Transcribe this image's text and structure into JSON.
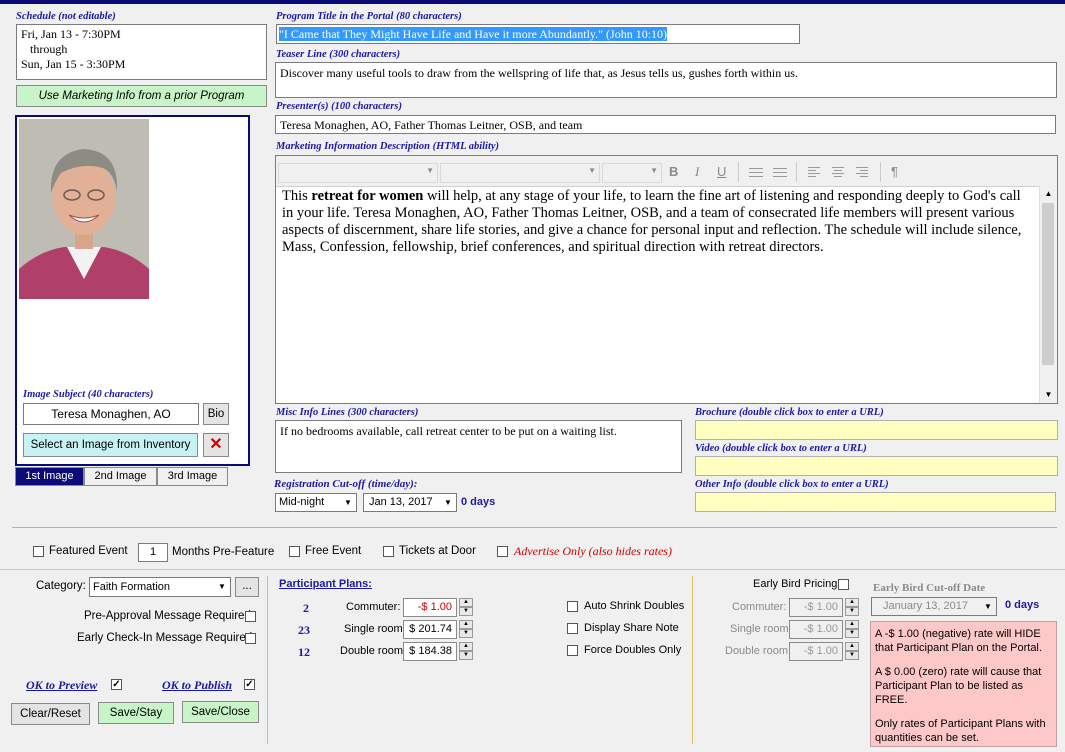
{
  "colors": {
    "accent": "#1a1aa6",
    "top_bar": "#0a0a78",
    "field_yellow": "#ffffc0",
    "button_green": "#c8f5c8",
    "info_pink": "#ffc8c8",
    "red": "#cc0000"
  },
  "schedule": {
    "label": "Schedule (not editable)",
    "line1": "Fri, Jan 13 - 7:30PM",
    "line2": "through",
    "line3": "Sun, Jan 15 - 3:30PM"
  },
  "marketing_button": "Use Marketing Info from a prior Program",
  "image": {
    "subject_label": "Image Subject (40 characters)",
    "subject_value": "Teresa Monaghen, AO",
    "bio_button": "Bio",
    "select_button": "Select an Image from Inventory",
    "tabs": [
      "1st Image",
      "2nd Image",
      "3rd Image"
    ]
  },
  "program_title": {
    "label": "Program Title in the Portal (80 characters)",
    "value": "\"I Came that They Might Have Life and Have it more Abundantly.\" (John 10:10)"
  },
  "teaser": {
    "label": "Teaser Line (300 characters)",
    "value": "Discover many useful tools to draw from the wellspring of life that, as Jesus tells us, gushes forth within us."
  },
  "presenters": {
    "label": "Presenter(s) (100 characters)",
    "value": "Teresa Monaghen, AO, Father Thomas Leitner, OSB, and team"
  },
  "description": {
    "label": "Marketing Information Description (HTML ability)",
    "toolbar": {
      "bold": "B",
      "italic": "I",
      "underline": "U",
      "pilcrow": "¶"
    },
    "part1": "This ",
    "bold_part": "retreat for women",
    "part2": " will help, at any stage of your life, to learn the fine art of listening and responding deeply to God's call in your life. Teresa Monaghen, AO, Father Thomas Leitner, OSB, and a team of consecrated life members will present various aspects of discernment, share life stories, and give a chance for personal input and reflection. The schedule will include silence, Mass, Confession, fellowship, brief conferences, and spiritual direction with retreat directors."
  },
  "misc": {
    "label": "Misc Info Lines (300 characters)",
    "value": "If no bedrooms available, call retreat center to be put on a waiting list."
  },
  "brochure_label": "Brochure (double click box to enter a URL)",
  "video_label": "Video (double click box to enter a URL)",
  "other_label": "Other Info (double click box to enter a URL)",
  "cutoff": {
    "label": "Registration Cut-off (time/day):",
    "time": "Mid-night",
    "date": "Jan 13, 2017",
    "days": "0 days"
  },
  "options": {
    "featured": "Featured Event",
    "months_value": "1",
    "months_label": "Months Pre-Feature",
    "free": "Free Event",
    "tickets": "Tickets at Door",
    "advertise": "Advertise Only (also hides rates)"
  },
  "category": {
    "label": "Category:",
    "value": "Faith Formation",
    "more": "..."
  },
  "pre_approval": "Pre-Approval Message Required",
  "early_checkin": "Early Check-In Message Required",
  "ok_preview": "OK to Preview",
  "ok_publish": "OK to Publish",
  "buttons": {
    "clear": "Clear/Reset",
    "save_stay": "Save/Stay",
    "save_close": "Save/Close"
  },
  "plans": {
    "title": "Participant Plans:",
    "rows": [
      {
        "count": "2",
        "label": "Commuter:",
        "value": "-$ 1.00"
      },
      {
        "count": "23",
        "label": "Single room",
        "value": "$ 201.74"
      },
      {
        "count": "12",
        "label": "Double room",
        "value": "$ 184.38"
      }
    ]
  },
  "doubles": {
    "auto_shrink": "Auto Shrink Doubles",
    "share_note": "Display Share Note",
    "force_doubles": "Force Doubles Only"
  },
  "early_bird": {
    "label": "Early Bird Pricing",
    "cutoff_label": "Early Bird Cut-off Date",
    "date": "January 13, 2017",
    "days": "0 days",
    "rows": [
      {
        "label": "Commuter:",
        "value": "-$ 1.00"
      },
      {
        "label": "Single room",
        "value": "-$ 1.00"
      },
      {
        "label": "Double room",
        "value": "-$ 1.00"
      }
    ]
  },
  "info": {
    "p1": "A -$ 1.00 (negative) rate will HIDE that Participant Plan on the Portal.",
    "p2": "A $ 0.00 (zero) rate will cause that Participant Plan to be listed as FREE.",
    "p3": "Only rates of Participant Plans with quantities can be set."
  },
  "checked_mark": "✓"
}
